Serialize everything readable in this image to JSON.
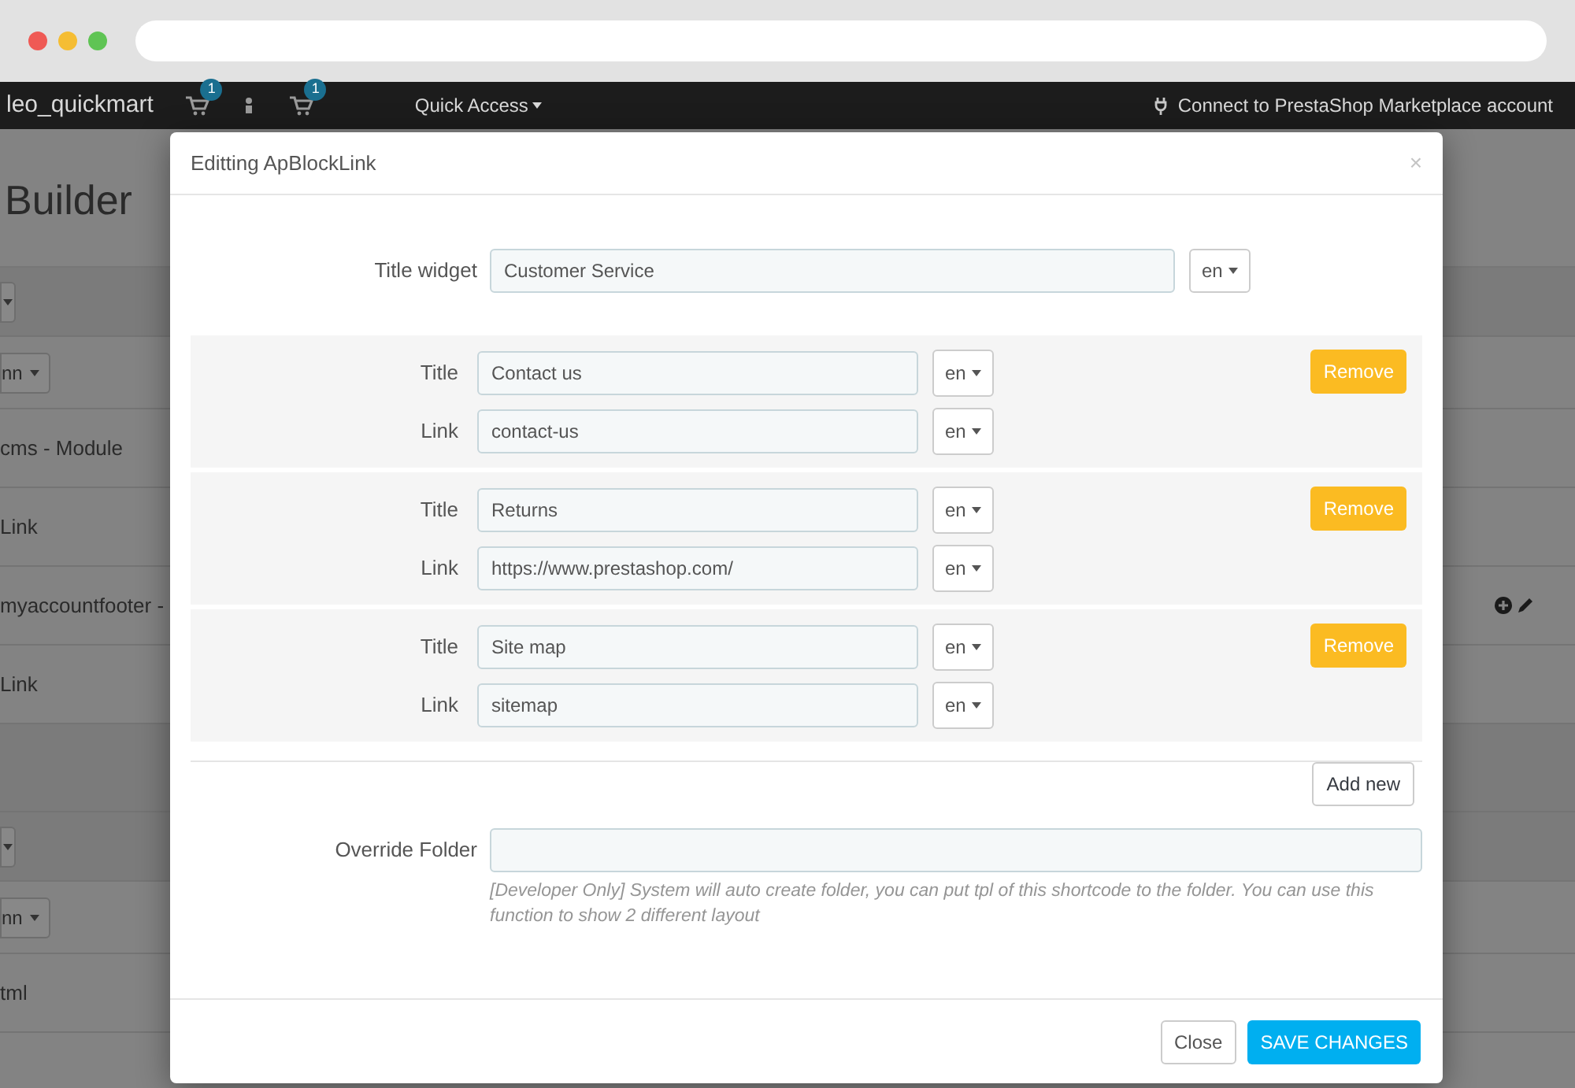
{
  "nav": {
    "shop_name": "leo_quickmart",
    "badges": [
      "1",
      "1"
    ],
    "quick_access": "Quick Access",
    "connect": "Connect to PrestaShop Marketplace account"
  },
  "background": {
    "heading": "Builder",
    "rows": [
      {
        "kind": "caret"
      },
      {
        "kind": "dropdown",
        "label": "nn"
      },
      {
        "kind": "text",
        "label": "cms - Module"
      },
      {
        "kind": "text",
        "label": "Link"
      },
      {
        "kind": "text",
        "label": "myaccountfooter -",
        "actions": true
      },
      {
        "kind": "text",
        "label": "Link"
      },
      {
        "kind": "blank"
      },
      {
        "kind": "caret"
      },
      {
        "kind": "dropdown",
        "label": "nn"
      },
      {
        "kind": "text",
        "label": "tml"
      }
    ]
  },
  "modal": {
    "title": "Editting ApBlockLink",
    "close": "×",
    "title_widget": {
      "label": "Title widget",
      "value": "Customer Service",
      "lang": "en"
    },
    "links": [
      {
        "title_label": "Title",
        "title": "Contact us",
        "title_lang": "en",
        "link_label": "Link",
        "link": "contact-us",
        "link_lang": "en",
        "remove": "Remove"
      },
      {
        "title_label": "Title",
        "title": "Returns",
        "title_lang": "en",
        "link_label": "Link",
        "link": "https://www.prestashop.com/",
        "link_lang": "en",
        "remove": "Remove"
      },
      {
        "title_label": "Title",
        "title": "Site map",
        "title_lang": "en",
        "link_label": "Link",
        "link": "sitemap",
        "link_lang": "en",
        "remove": "Remove"
      }
    ],
    "add_new": "Add new",
    "override": {
      "label": "Override Folder",
      "help": "[Developer Only] System will auto create folder, you can put tpl of this shortcode to the folder. You can use this function to show 2 different layout"
    },
    "buttons": [
      {
        "kind": "default",
        "label": "Close"
      },
      {
        "kind": "primary",
        "label": "SAVE CHANGES"
      }
    ]
  }
}
